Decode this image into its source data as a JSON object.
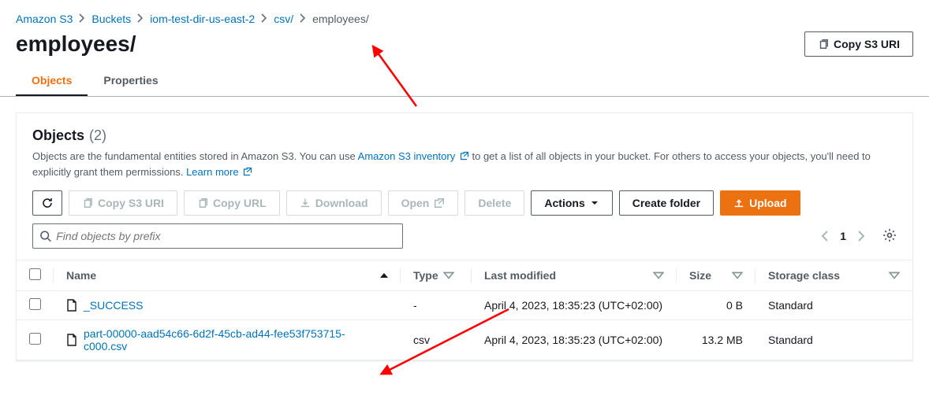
{
  "breadcrumb": {
    "items": [
      {
        "label": "Amazon S3"
      },
      {
        "label": "Buckets"
      },
      {
        "label": "iom-test-dir-us-east-2"
      },
      {
        "label": "csv/"
      }
    ],
    "current": "employees/"
  },
  "header": {
    "title": "employees/",
    "copy_uri_label": "Copy S3 URI"
  },
  "tabs": {
    "objects": "Objects",
    "properties": "Properties"
  },
  "panel": {
    "title": "Objects",
    "count": "(2)",
    "desc_pre": "Objects are the fundamental entities stored in Amazon S3. You can use ",
    "desc_link1": "Amazon S3 inventory",
    "desc_mid": " to get a list of all objects in your bucket. For others to access your objects, you'll need to explicitly grant them permissions. ",
    "desc_link2": "Learn more"
  },
  "toolbar": {
    "copy_uri": "Copy S3 URI",
    "copy_url": "Copy URL",
    "download": "Download",
    "open": "Open",
    "delete": "Delete",
    "actions": "Actions",
    "create_folder": "Create folder",
    "upload": "Upload"
  },
  "search": {
    "placeholder": "Find objects by prefix"
  },
  "pager": {
    "page": "1"
  },
  "columns": {
    "name": "Name",
    "type": "Type",
    "last_modified": "Last modified",
    "size": "Size",
    "storage_class": "Storage class"
  },
  "rows": [
    {
      "name": "_SUCCESS",
      "type": "-",
      "last_modified": "April 4, 2023, 18:35:23 (UTC+02:00)",
      "size": "0 B",
      "storage_class": "Standard"
    },
    {
      "name": "part-00000-aad54c66-6d2f-45cb-ad44-fee53f753715-c000.csv",
      "type": "csv",
      "last_modified": "April 4, 2023, 18:35:23 (UTC+02:00)",
      "size": "13.2 MB",
      "storage_class": "Standard"
    }
  ]
}
